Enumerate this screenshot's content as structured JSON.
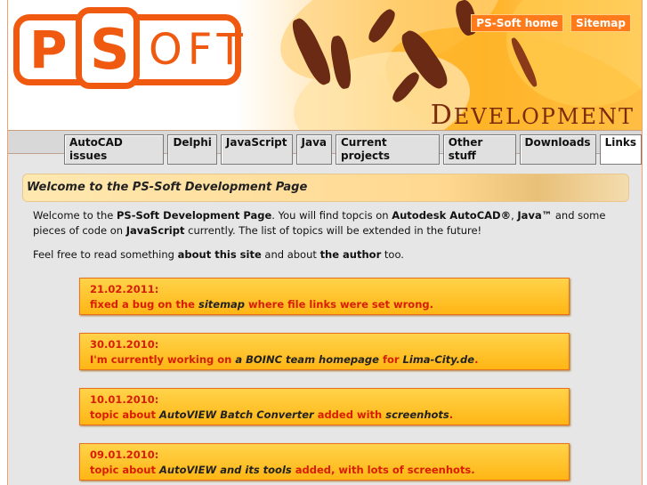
{
  "header": {
    "logo_letters": [
      "P",
      "S",
      "OFT"
    ],
    "tagline": {
      "cap": "D",
      "rest": "EVELOPMENT"
    },
    "top_links": [
      "PS-Soft home",
      "Sitemap"
    ]
  },
  "nav": {
    "items": [
      "AutoCAD issues",
      "Delphi",
      "JavaScript",
      "Java",
      "Current projects",
      "Other stuff",
      "Downloads",
      "Links"
    ],
    "active": "Links"
  },
  "welcome": {
    "title": "Welcome to the PS-Soft Development Page",
    "intro": {
      "p1": "Welcome to the ",
      "b1": "PS-Soft Development Page",
      "p2": ". You will find topcis on ",
      "b2": "Autodesk AutoCAD®",
      "p3": ", ",
      "b3": "Java™",
      "p4": " and some pieces of code on ",
      "b4": "JavaScript",
      "p5": " currently. The list of topics will be extended in the future!"
    },
    "intro2": {
      "p1": "Feel free to read something ",
      "b1": "about this site",
      "p2": " and about ",
      "b2": "the author",
      "p3": " too."
    }
  },
  "news": [
    {
      "date": "21.02.2011:",
      "t1": "fixed a bug on the ",
      "i1": "sitemap",
      "t2": " where file links were set wrong.",
      "i2": "",
      "t3": ""
    },
    {
      "date": "30.01.2010:",
      "t1": "I'm currently working on ",
      "i1": "a BOINC team homepage",
      "t2": " for ",
      "i2": "Lima-City.de",
      "t3": "."
    },
    {
      "date": "10.01.2010:",
      "t1": "topic about ",
      "i1": "AutoVIEW Batch Converter",
      "t2": " added with ",
      "i2": "screenhots",
      "t3": "."
    },
    {
      "date": "09.01.2010:",
      "t1": "topic about ",
      "i1": "AutoVIEW and its tools",
      "t2": " added, with lots of screenhots.",
      "i2": "",
      "t3": ""
    }
  ],
  "colors": {
    "accent": "#f05a10",
    "news_text": "#d81e00",
    "news_bg": "#ffc21e"
  }
}
